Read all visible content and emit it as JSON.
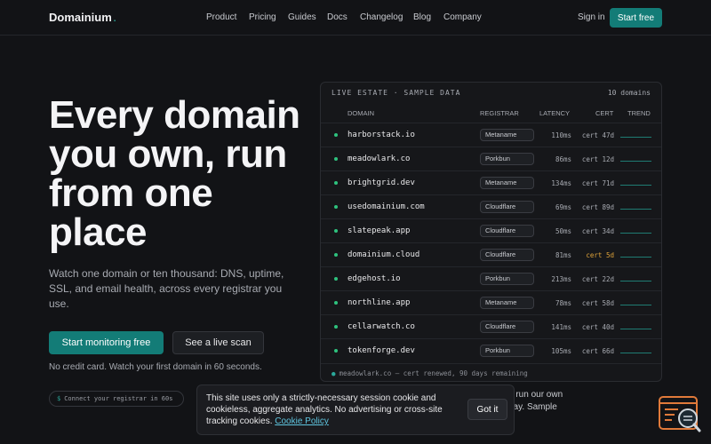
{
  "nav": {
    "brand": "Domainium",
    "brand_dot": ".",
    "links": [
      "Product",
      "Pricing",
      "Guides",
      "Docs",
      "Changelog",
      "Blog",
      "Company"
    ],
    "sign_in": "Sign in",
    "start_free": "Start free"
  },
  "hero": {
    "title": "Every domain you own, run from one place",
    "subtitle": "Watch one domain or ten thousand: DNS, uptime, SSL, and email health, across every registrar you use.",
    "primary_cta": "Start monitoring free",
    "secondary_cta": "See a live scan",
    "note": "No credit card. Watch your first domain in 60 seconds.",
    "cli_prompt": "$",
    "cli_text": "Connect your registrar in 60s"
  },
  "panel": {
    "title": "LIVE ESTATE · SAMPLE DATA",
    "count": "10 domains",
    "columns": {
      "domain": "DOMAIN",
      "registrar": "REGISTRAR",
      "latency": "LATENCY",
      "cert": "CERT",
      "trend": "TREND"
    },
    "rows": [
      {
        "domain": "harborstack.io",
        "registrar": "Metaname",
        "latency": "110ms",
        "cert": "cert 47d"
      },
      {
        "domain": "meadowlark.co",
        "registrar": "Porkbun",
        "latency": "86ms",
        "cert": "cert 12d"
      },
      {
        "domain": "brightgrid.dev",
        "registrar": "Metaname",
        "latency": "134ms",
        "cert": "cert 71d"
      },
      {
        "domain": "usedomainium.com",
        "registrar": "Cloudflare",
        "latency": "69ms",
        "cert": "cert 89d"
      },
      {
        "domain": "slatepeak.app",
        "registrar": "Cloudflare",
        "latency": "50ms",
        "cert": "cert 34d"
      },
      {
        "domain": "domainium.cloud",
        "registrar": "Cloudflare",
        "latency": "81ms",
        "cert": "cert 5d"
      },
      {
        "domain": "edgehost.io",
        "registrar": "Porkbun",
        "latency": "213ms",
        "cert": "cert 22d"
      },
      {
        "domain": "northline.app",
        "registrar": "Metaname",
        "latency": "78ms",
        "cert": "cert 58d"
      },
      {
        "domain": "cellarwatch.co",
        "registrar": "Cloudflare",
        "latency": "141ms",
        "cert": "cert 40d"
      },
      {
        "domain": "tokenforge.dev",
        "registrar": "Porkbun",
        "latency": "105ms",
        "cert": "cert 66d"
      }
    ],
    "footer_dot": "●",
    "footer": "meadowlark.co — cert renewed, 90 days remaining"
  },
  "behind_text": {
    "line1": "e run our own",
    "line2": "day. Sample"
  },
  "cookie": {
    "text": "This site uses only a strictly-necessary session cookie and cookieless, aggregate analytics. No advertising or cross-site tracking cookies.",
    "link": "Cookie Policy",
    "button": "Got it"
  },
  "colors": {
    "accent": "#137c77",
    "status_ok": "#2ec27e",
    "warn": "#e0a43a",
    "widget": "#e07a3a"
  },
  "icons": {
    "widget": "chat-search-icon"
  }
}
